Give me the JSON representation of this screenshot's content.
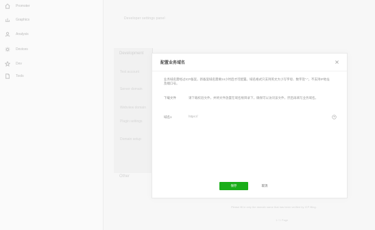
{
  "sidebar": {
    "items": [
      {
        "label": "Promoter",
        "icon": "home-icon"
      },
      {
        "label": "Graphics",
        "icon": "chart-icon"
      },
      {
        "label": "Analysis",
        "icon": "user-icon"
      },
      {
        "label": "Devices",
        "icon": "settings-icon"
      },
      {
        "label": "Dev",
        "icon": "star-icon"
      },
      {
        "label": "Tools",
        "icon": "document-icon"
      }
    ]
  },
  "background": {
    "top_text": "Developer settings panel",
    "section_heading": "Development",
    "section_items": [
      "Test account",
      "Server domain",
      "Webview domain",
      "Plugin settings",
      "Domain setup"
    ],
    "bottom_heading": "Other",
    "note": "Please fill in only the domain name that has been verified by ICP filing.",
    "pager": "1 / 1 Page"
  },
  "dialog": {
    "title": "配置业务域名",
    "paragraph": "业务域名需经过ICP备案，新备案域名需要24小时后才可配置。域名格式只支持英文大小写字母、数字及“-”，不支持IP地址及端口号。",
    "row1": {
      "label": "下载文件",
      "value": "请下载校验文件，并将文件放置在域名根目录下，确保可以访问该文件，然后再填写业务域名。"
    },
    "row2": {
      "label": "域名1",
      "value": "https://",
      "help_icon": "help-icon"
    },
    "buttons": {
      "save": "保存",
      "cancel": "取消"
    }
  },
  "colors": {
    "accent": "#1aad19",
    "overlay": "#f7f7f7",
    "border": "#e9e9e9"
  }
}
